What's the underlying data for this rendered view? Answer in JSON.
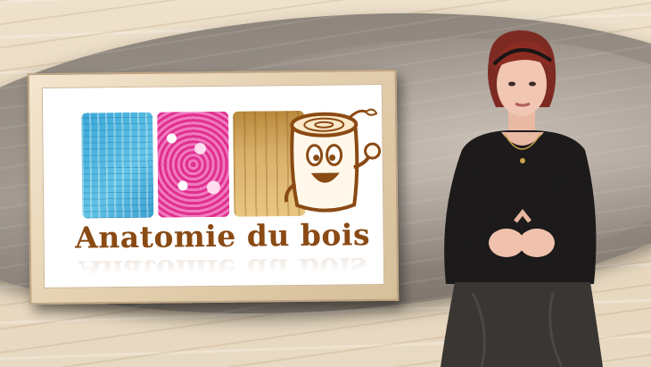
{
  "board": {
    "title": "Anatomie du bois"
  },
  "colors": {
    "title_brown": "#8a4a14",
    "frame_wood": "#e3cfae",
    "swoosh_grey": "#9a9189",
    "presenter_top": "#1c1a1a",
    "presenter_hair": "#8b2c22"
  },
  "icons": {
    "mascot": "log-mascot-icon",
    "tiles": [
      "blue-wood-cells-micrograph",
      "pink-wood-cells-micrograph",
      "wood-planks-photo"
    ]
  }
}
